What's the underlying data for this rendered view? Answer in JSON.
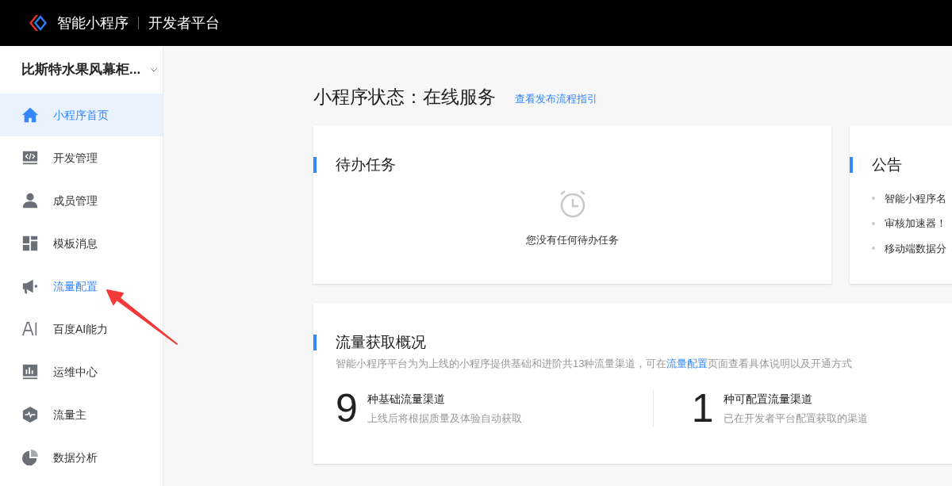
{
  "header": {
    "product": "智能小程序",
    "platform": "开发者平台"
  },
  "sidebar": {
    "app_name": "比斯特水果风幕柜...",
    "items": [
      {
        "kind": "home",
        "label": "小程序首页",
        "selected": true,
        "hovered": false
      },
      {
        "kind": "code",
        "label": "开发管理",
        "selected": false,
        "hovered": false
      },
      {
        "kind": "member",
        "label": "成员管理",
        "selected": false,
        "hovered": false
      },
      {
        "kind": "template",
        "label": "模板消息",
        "selected": false,
        "hovered": false
      },
      {
        "kind": "megaphone",
        "label": "流量配置",
        "selected": false,
        "hovered": true
      },
      {
        "kind": "ai",
        "label": "百度AI能力",
        "selected": false,
        "hovered": false
      },
      {
        "kind": "ops",
        "label": "运维中心",
        "selected": false,
        "hovered": false
      },
      {
        "kind": "hexagon",
        "label": "流量主",
        "selected": false,
        "hovered": false
      },
      {
        "kind": "pie",
        "label": "数据分析",
        "selected": false,
        "hovered": false
      }
    ]
  },
  "status": {
    "title": "小程序状态：在线服务",
    "guide_link": "查看发布流程指引"
  },
  "todo": {
    "title": "待办任务",
    "empty_text": "您没有任何待办任务"
  },
  "notice": {
    "title": "公告",
    "items": [
      "智能小程序名",
      "审核加速器！",
      "移动端数据分"
    ]
  },
  "traffic": {
    "title": "流量获取概况",
    "desc_before": "智能小程序平台为为上线的小程序提供基础和进阶共13种流量渠道，可在",
    "desc_link": "流量配置",
    "desc_after": "页面查看具体说明以及开通方式",
    "stats": [
      {
        "number": "9",
        "label": "种基础流量渠道",
        "sub": "上线后将根据质量及体验自动获取"
      },
      {
        "number": "1",
        "label": "种可配置流量渠道",
        "sub": "已在开发者平台配置获取的渠道"
      }
    ]
  }
}
